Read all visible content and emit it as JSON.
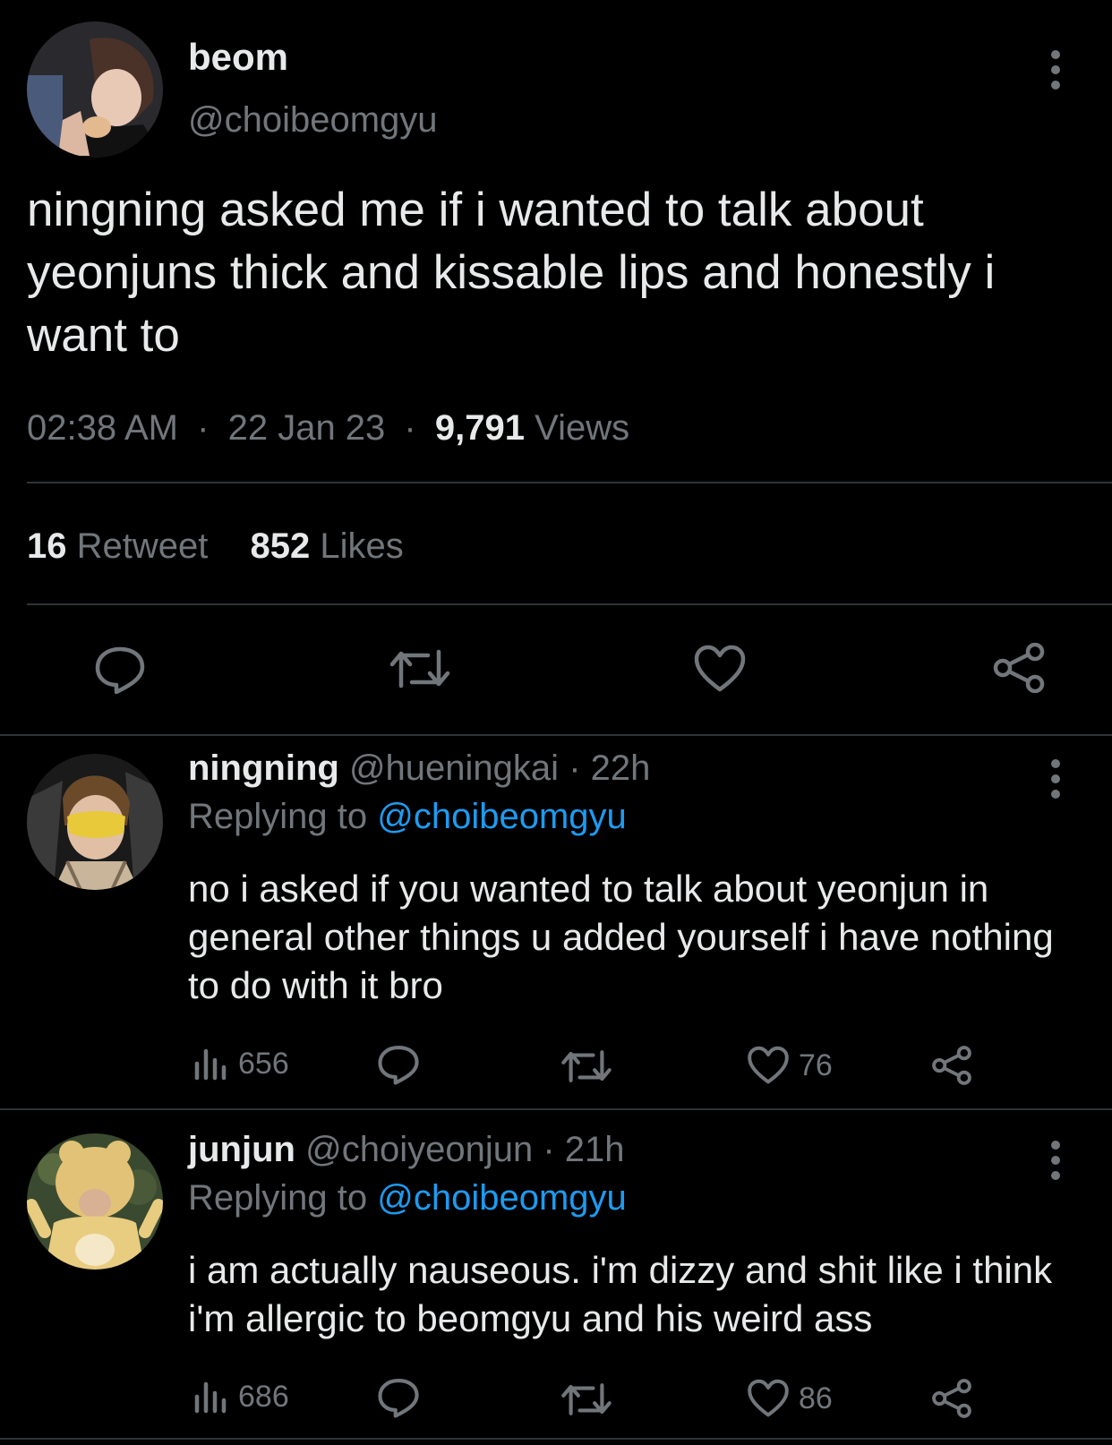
{
  "main_tweet": {
    "display_name": "beom",
    "handle": "@choibeomgyu",
    "text": "ningning asked me if i wanted to talk about yeonjuns thick and kissable lips and honestly i want to",
    "time": "02:38 AM",
    "date": "22 Jan 23",
    "dot": "·",
    "views_count": "9,791",
    "views_label": "Views",
    "retweets_count": "16",
    "retweets_label": "Retweet",
    "likes_count": "852",
    "likes_label": "Likes"
  },
  "replies": [
    {
      "display_name": "ningning",
      "handle": "@hueningkai",
      "time": "· 22h",
      "replying_prefix": "Replying to",
      "replying_to": "@choibeomgyu",
      "text": "no i asked if you wanted to talk about yeonjun in general other things u added yourself i have nothing to do with it bro",
      "views": "656",
      "likes": "76"
    },
    {
      "display_name": "junjun",
      "handle": "@choiyeonjun",
      "time": "· 21h",
      "replying_prefix": "Replying to",
      "replying_to": "@choibeomgyu",
      "text": "i am actually nauseous. i'm dizzy and shit like i think i'm allergic to beomgyu and his weird ass",
      "views": "686",
      "likes": "86"
    }
  ],
  "icons": {
    "reply": "speech-bubble-icon",
    "retweet": "retweet-arrows-icon",
    "like": "heart-icon",
    "share": "share-nodes-icon",
    "views": "bar-chart-icon",
    "more": "vertical-dots-icon"
  },
  "colors": {
    "background": "#000000",
    "text": "#e7e9ea",
    "muted": "#71767b",
    "link": "#1d9bf0",
    "divider": "#2f3336"
  }
}
